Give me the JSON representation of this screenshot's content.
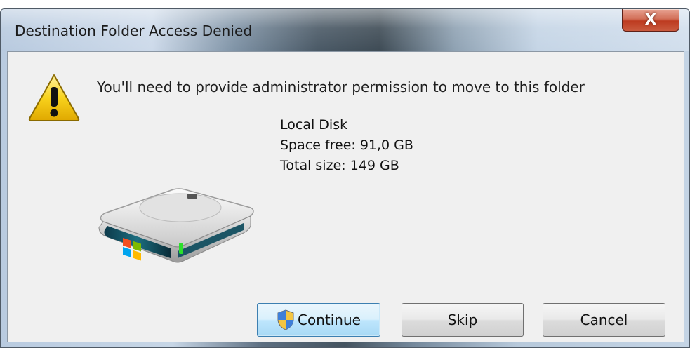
{
  "window": {
    "title": "Destination Folder Access Denied",
    "close_glyph": "X"
  },
  "message": "You'll need to provide administrator permission to move to this folder",
  "disk": {
    "name": "Local Disk",
    "space_free": "Space free: 91,0 GB",
    "total_size": "Total size: 149 GB"
  },
  "buttons": {
    "continue": "Continue",
    "skip": "Skip",
    "cancel": "Cancel"
  },
  "icons": {
    "warning": "warning-icon",
    "drive": "hard-drive-icon",
    "shield": "uac-shield-icon",
    "close": "close-icon"
  },
  "colors": {
    "close_button": "#c95a3e",
    "warning_yellow": "#f5c800",
    "default_button_border": "#3c7fb1"
  }
}
